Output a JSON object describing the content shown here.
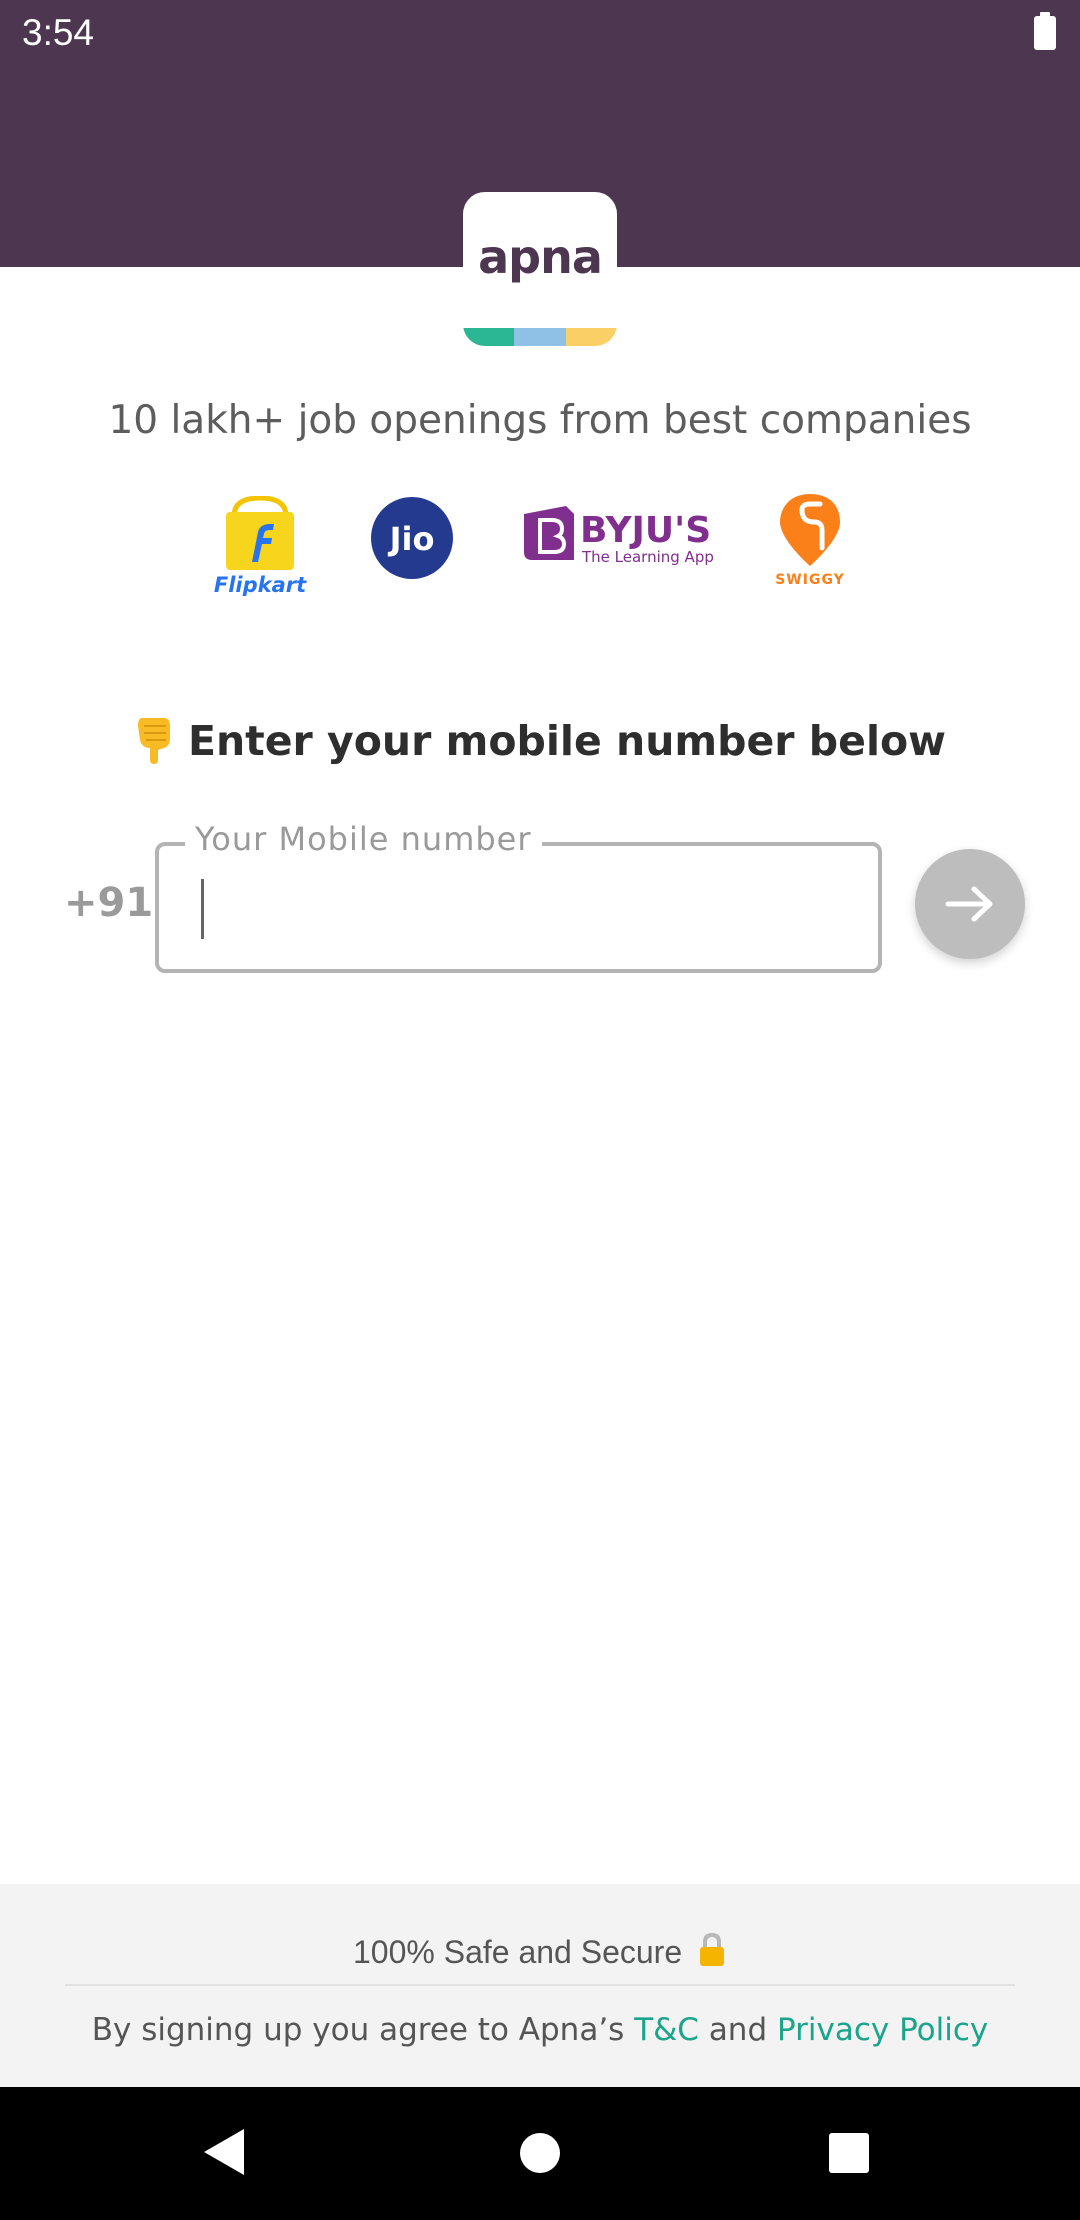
{
  "status_bar": {
    "time": "3:54"
  },
  "brand": {
    "logo_text": "apna",
    "stripe_colors": [
      "#2bb793",
      "#8ec1e5",
      "#f9cf66"
    ],
    "header_color": "#4d3650"
  },
  "headline": "10 lakh+ job openings from best companies",
  "companies": [
    {
      "name": "Flipkart",
      "icon": "flipkart-logo"
    },
    {
      "name": "Jio",
      "icon": "jio-logo"
    },
    {
      "name": "BYJU'S",
      "tagline": "The Learning App",
      "icon": "byjus-logo"
    },
    {
      "name": "SWIGGY",
      "icon": "swiggy-logo"
    }
  ],
  "prompt": {
    "emoji": "👇",
    "text": "Enter your mobile number below"
  },
  "phone": {
    "country_code": "+91",
    "label": "Your Mobile number",
    "value": ""
  },
  "submit": {
    "icon": "arrow-right-icon"
  },
  "footer": {
    "secure_text": "100% Safe and Secure",
    "secure_icon": "lock-icon",
    "terms_prefix": "By signing up you agree to Apna’s",
    "terms_link": "T&C",
    "terms_and": "and",
    "privacy_link": "Privacy Policy",
    "link_color": "#1aa58a"
  },
  "nav": {
    "back": "back-icon",
    "home": "home-icon",
    "recents": "recents-icon"
  }
}
